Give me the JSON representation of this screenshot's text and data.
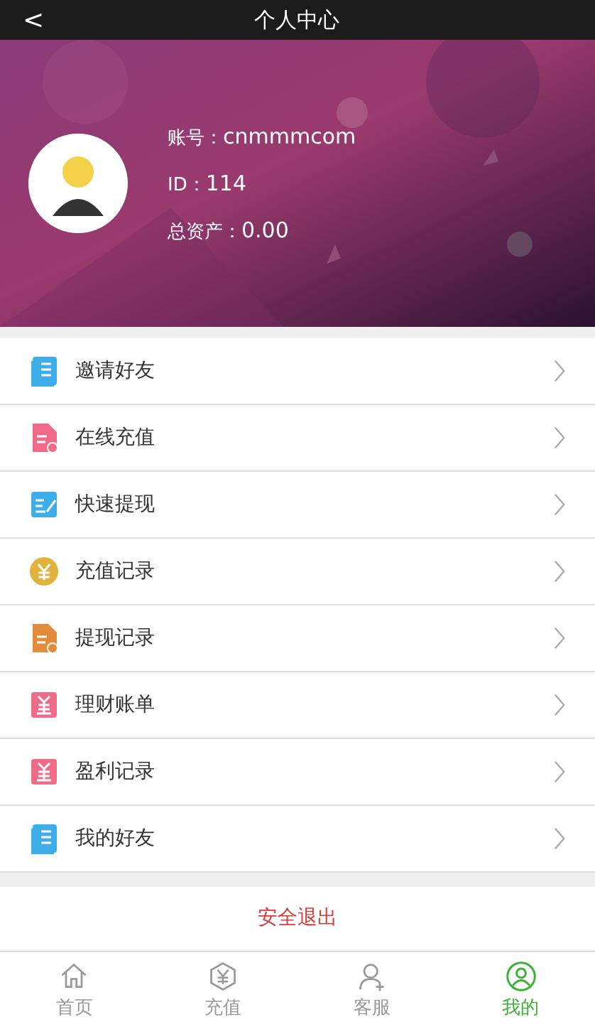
{
  "header": {
    "back": "<",
    "title": "个人中心"
  },
  "profile": {
    "account_label": "账号：",
    "account": "cnmmmcom",
    "id_label": "ID：",
    "id": "114",
    "assets_label": "总资产：",
    "assets": "0.00"
  },
  "menu": [
    {
      "label": "邀请好友",
      "kind": "book",
      "color": "#3daee9"
    },
    {
      "label": "在线充值",
      "kind": "doc",
      "color": "#f06b8a"
    },
    {
      "label": "快速提现",
      "kind": "edit",
      "color": "#3daee9"
    },
    {
      "label": "充值记录",
      "kind": "coin",
      "color": "#e3b23c"
    },
    {
      "label": "提现记录",
      "kind": "doc",
      "color": "#e38b38"
    },
    {
      "label": "理财账单",
      "kind": "yen",
      "color": "#f06b8a"
    },
    {
      "label": "盈利记录",
      "kind": "yen",
      "color": "#f06b8a"
    },
    {
      "label": "我的好友",
      "kind": "book",
      "color": "#3daee9"
    }
  ],
  "logout": "安全退出",
  "tabs": [
    {
      "label": "首页",
      "kind": "home",
      "selected": false
    },
    {
      "label": "充值",
      "kind": "yen",
      "selected": false
    },
    {
      "label": "客服",
      "kind": "service",
      "selected": false
    },
    {
      "label": "我的",
      "kind": "me",
      "selected": true
    }
  ]
}
